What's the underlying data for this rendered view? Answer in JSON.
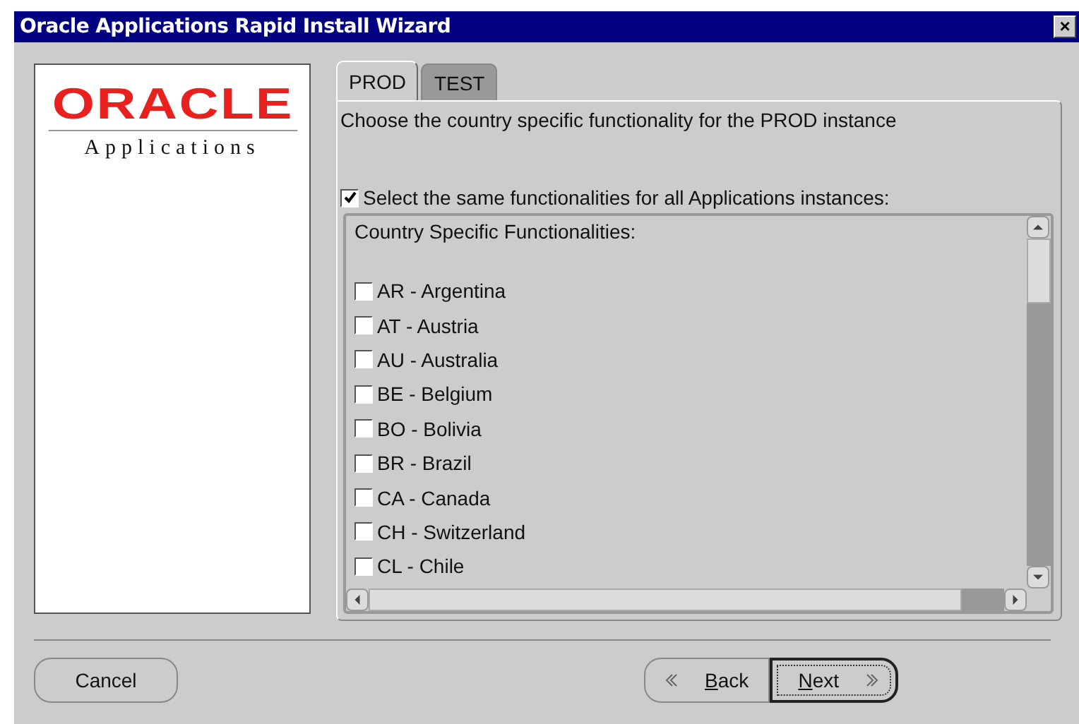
{
  "window": {
    "title": "Oracle Applications Rapid Install Wizard",
    "close": "×"
  },
  "logo": {
    "brand": "ORACLE",
    "product": "Applications"
  },
  "tabs": [
    {
      "label": "PROD",
      "selected": true
    },
    {
      "label": "TEST",
      "selected": false
    }
  ],
  "instruction": "Choose the country specific functionality for the PROD instance",
  "same_for_all": {
    "label": "Select the same functionalities for all Applications instances:",
    "checked": true
  },
  "list": {
    "heading": "Country Specific Functionalities:",
    "items": [
      {
        "label": "AR - Argentina",
        "checked": false
      },
      {
        "label": "AT - Austria",
        "checked": false
      },
      {
        "label": "AU - Australia",
        "checked": false
      },
      {
        "label": "BE - Belgium",
        "checked": false
      },
      {
        "label": "BO - Bolivia",
        "checked": false
      },
      {
        "label": "BR - Brazil",
        "checked": false
      },
      {
        "label": "CA - Canada",
        "checked": false
      },
      {
        "label": "CH - Switzerland",
        "checked": false
      },
      {
        "label": "CL - Chile",
        "checked": false
      }
    ]
  },
  "buttons": [
    {
      "label": "Cancel",
      "kind": "plain"
    },
    {
      "label": "Back",
      "kind": "back"
    },
    {
      "label": "Next",
      "kind": "next"
    }
  ]
}
